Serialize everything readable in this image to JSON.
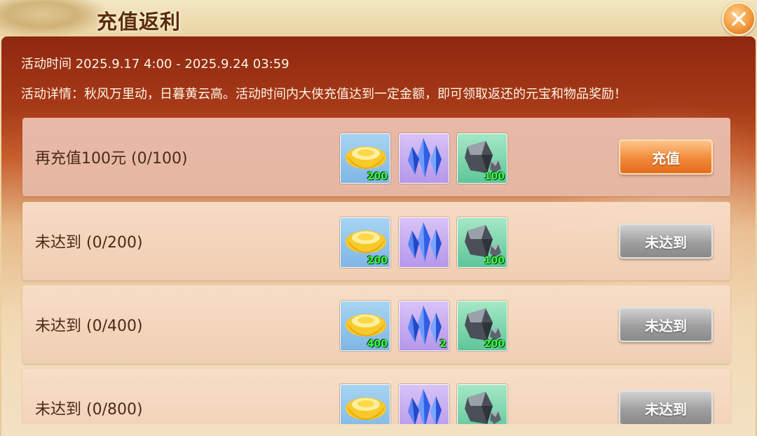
{
  "window": {
    "title": "充值返利"
  },
  "event": {
    "time": "活动时间 2025.9.17 4:00 - 2025.9.24 03:59",
    "detail": "活动详情：秋风万里动，日暮黄云高。活动时间内大侠充值达到一定金额，即可领取返还的元宝和物品奖励！"
  },
  "rows": [
    {
      "label": "再充值100元 (0/100)",
      "button": "充值",
      "state": "active",
      "rewards": [
        {
          "icon": "gold-ingot-icon",
          "qty": "200"
        },
        {
          "icon": "blue-crystal-icon",
          "qty": ""
        },
        {
          "icon": "ore-stone-icon",
          "qty": "100"
        }
      ]
    },
    {
      "label": "未达到 (0/200)",
      "button": "未达到",
      "state": "disabled",
      "rewards": [
        {
          "icon": "gold-ingot-icon",
          "qty": "200"
        },
        {
          "icon": "blue-crystal-icon",
          "qty": ""
        },
        {
          "icon": "ore-stone-icon",
          "qty": "100"
        }
      ]
    },
    {
      "label": "未达到 (0/400)",
      "button": "未达到",
      "state": "disabled",
      "rewards": [
        {
          "icon": "gold-ingot-icon",
          "qty": "400"
        },
        {
          "icon": "blue-crystal-icon",
          "qty": "2"
        },
        {
          "icon": "ore-stone-icon",
          "qty": "200"
        }
      ]
    },
    {
      "label": "未达到 (0/800)",
      "button": "未达到",
      "state": "disabled",
      "rewards": [
        {
          "icon": "gold-ingot-icon",
          "qty": ""
        },
        {
          "icon": "blue-crystal-icon",
          "qty": ""
        },
        {
          "icon": "ore-stone-icon",
          "qty": ""
        }
      ]
    }
  ],
  "colors": {
    "accent": "#f2893a",
    "disabled": "#9e9e9e",
    "qty": "#3bff4f",
    "header": "#8f2710"
  }
}
